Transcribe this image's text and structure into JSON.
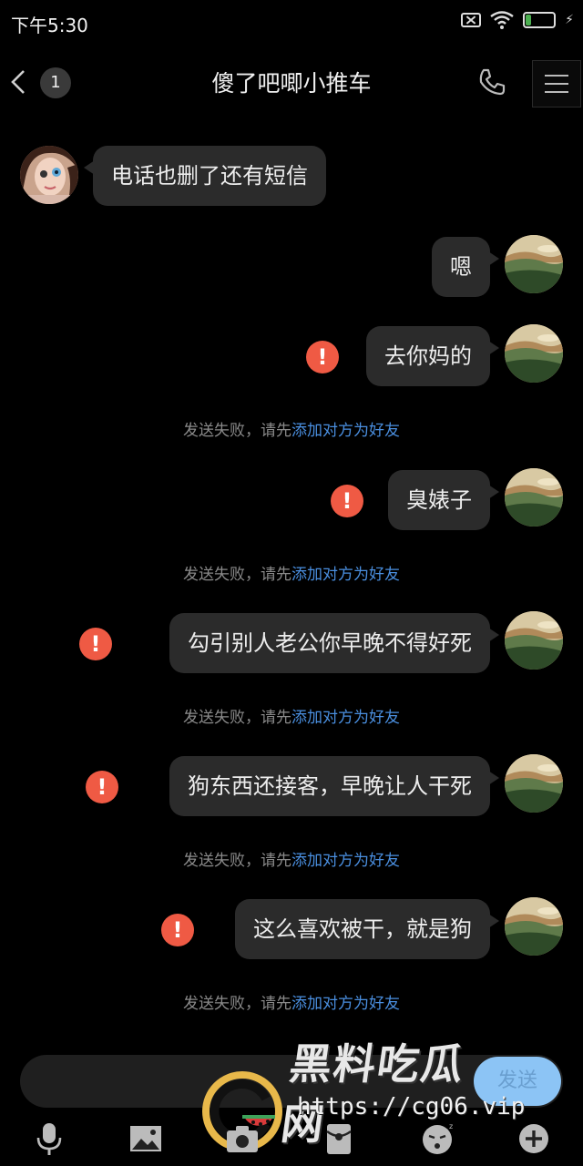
{
  "status": {
    "time": "下午5:30",
    "battery": "21",
    "battery_fraction": 0.21
  },
  "header": {
    "back_label": "<",
    "unread_count": "1",
    "title": "傻了吧唧小推车"
  },
  "messages": [
    {
      "side": "left",
      "text": "电话也删了还有短信"
    },
    {
      "side": "right",
      "text": "嗯"
    },
    {
      "side": "right",
      "text": "去你妈的",
      "failed": true
    },
    {
      "side": "right",
      "text": "臭婊子",
      "failed": true
    },
    {
      "side": "right",
      "text": "勾引别人老公你早晚不得好死",
      "failed": true
    },
    {
      "side": "right",
      "text": "狗东西还接客，早晚让人干死",
      "failed": true
    },
    {
      "side": "right",
      "text": "这么喜欢被干，就是狗",
      "failed": true
    }
  ],
  "notice": {
    "prefix": "发送失败，请先",
    "link": "添加对方为好友"
  },
  "fail_mark": "!",
  "input": {
    "send_label": "发送"
  },
  "toolbar": [
    "mic-icon",
    "image-icon",
    "camera-icon",
    "red-packet-icon",
    "emoji-icon",
    "plus-icon"
  ],
  "watermark": {
    "title": "黑料吃瓜网",
    "url": "https://cg06.vip"
  },
  "colors": {
    "bubble": "#2b2b2b",
    "fail": "#ef5a44",
    "link": "#4a8fe0",
    "send": "#8cc4f5",
    "background": "#000000"
  }
}
